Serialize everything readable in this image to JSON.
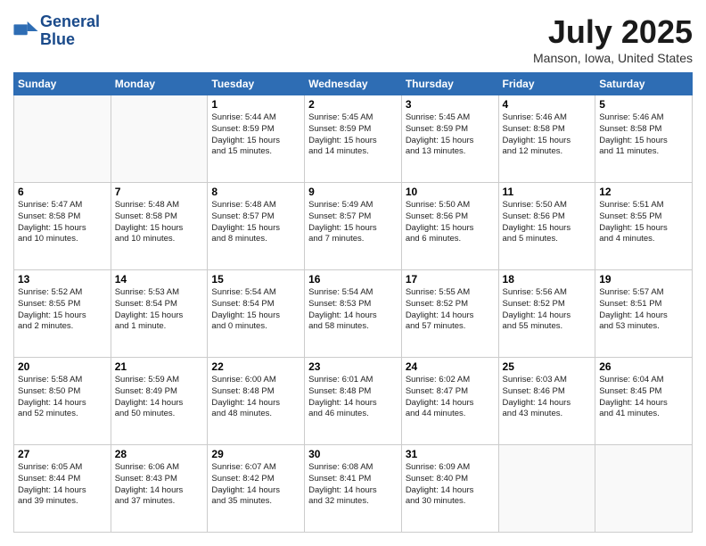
{
  "header": {
    "logo_line1": "General",
    "logo_line2": "Blue",
    "month": "July 2025",
    "location": "Manson, Iowa, United States"
  },
  "weekdays": [
    "Sunday",
    "Monday",
    "Tuesday",
    "Wednesday",
    "Thursday",
    "Friday",
    "Saturday"
  ],
  "weeks": [
    [
      {
        "day": "",
        "info": ""
      },
      {
        "day": "",
        "info": ""
      },
      {
        "day": "1",
        "info": "Sunrise: 5:44 AM\nSunset: 8:59 PM\nDaylight: 15 hours\nand 15 minutes."
      },
      {
        "day": "2",
        "info": "Sunrise: 5:45 AM\nSunset: 8:59 PM\nDaylight: 15 hours\nand 14 minutes."
      },
      {
        "day": "3",
        "info": "Sunrise: 5:45 AM\nSunset: 8:59 PM\nDaylight: 15 hours\nand 13 minutes."
      },
      {
        "day": "4",
        "info": "Sunrise: 5:46 AM\nSunset: 8:58 PM\nDaylight: 15 hours\nand 12 minutes."
      },
      {
        "day": "5",
        "info": "Sunrise: 5:46 AM\nSunset: 8:58 PM\nDaylight: 15 hours\nand 11 minutes."
      }
    ],
    [
      {
        "day": "6",
        "info": "Sunrise: 5:47 AM\nSunset: 8:58 PM\nDaylight: 15 hours\nand 10 minutes."
      },
      {
        "day": "7",
        "info": "Sunrise: 5:48 AM\nSunset: 8:58 PM\nDaylight: 15 hours\nand 10 minutes."
      },
      {
        "day": "8",
        "info": "Sunrise: 5:48 AM\nSunset: 8:57 PM\nDaylight: 15 hours\nand 8 minutes."
      },
      {
        "day": "9",
        "info": "Sunrise: 5:49 AM\nSunset: 8:57 PM\nDaylight: 15 hours\nand 7 minutes."
      },
      {
        "day": "10",
        "info": "Sunrise: 5:50 AM\nSunset: 8:56 PM\nDaylight: 15 hours\nand 6 minutes."
      },
      {
        "day": "11",
        "info": "Sunrise: 5:50 AM\nSunset: 8:56 PM\nDaylight: 15 hours\nand 5 minutes."
      },
      {
        "day": "12",
        "info": "Sunrise: 5:51 AM\nSunset: 8:55 PM\nDaylight: 15 hours\nand 4 minutes."
      }
    ],
    [
      {
        "day": "13",
        "info": "Sunrise: 5:52 AM\nSunset: 8:55 PM\nDaylight: 15 hours\nand 2 minutes."
      },
      {
        "day": "14",
        "info": "Sunrise: 5:53 AM\nSunset: 8:54 PM\nDaylight: 15 hours\nand 1 minute."
      },
      {
        "day": "15",
        "info": "Sunrise: 5:54 AM\nSunset: 8:54 PM\nDaylight: 15 hours\nand 0 minutes."
      },
      {
        "day": "16",
        "info": "Sunrise: 5:54 AM\nSunset: 8:53 PM\nDaylight: 14 hours\nand 58 minutes."
      },
      {
        "day": "17",
        "info": "Sunrise: 5:55 AM\nSunset: 8:52 PM\nDaylight: 14 hours\nand 57 minutes."
      },
      {
        "day": "18",
        "info": "Sunrise: 5:56 AM\nSunset: 8:52 PM\nDaylight: 14 hours\nand 55 minutes."
      },
      {
        "day": "19",
        "info": "Sunrise: 5:57 AM\nSunset: 8:51 PM\nDaylight: 14 hours\nand 53 minutes."
      }
    ],
    [
      {
        "day": "20",
        "info": "Sunrise: 5:58 AM\nSunset: 8:50 PM\nDaylight: 14 hours\nand 52 minutes."
      },
      {
        "day": "21",
        "info": "Sunrise: 5:59 AM\nSunset: 8:49 PM\nDaylight: 14 hours\nand 50 minutes."
      },
      {
        "day": "22",
        "info": "Sunrise: 6:00 AM\nSunset: 8:48 PM\nDaylight: 14 hours\nand 48 minutes."
      },
      {
        "day": "23",
        "info": "Sunrise: 6:01 AM\nSunset: 8:48 PM\nDaylight: 14 hours\nand 46 minutes."
      },
      {
        "day": "24",
        "info": "Sunrise: 6:02 AM\nSunset: 8:47 PM\nDaylight: 14 hours\nand 44 minutes."
      },
      {
        "day": "25",
        "info": "Sunrise: 6:03 AM\nSunset: 8:46 PM\nDaylight: 14 hours\nand 43 minutes."
      },
      {
        "day": "26",
        "info": "Sunrise: 6:04 AM\nSunset: 8:45 PM\nDaylight: 14 hours\nand 41 minutes."
      }
    ],
    [
      {
        "day": "27",
        "info": "Sunrise: 6:05 AM\nSunset: 8:44 PM\nDaylight: 14 hours\nand 39 minutes."
      },
      {
        "day": "28",
        "info": "Sunrise: 6:06 AM\nSunset: 8:43 PM\nDaylight: 14 hours\nand 37 minutes."
      },
      {
        "day": "29",
        "info": "Sunrise: 6:07 AM\nSunset: 8:42 PM\nDaylight: 14 hours\nand 35 minutes."
      },
      {
        "day": "30",
        "info": "Sunrise: 6:08 AM\nSunset: 8:41 PM\nDaylight: 14 hours\nand 32 minutes."
      },
      {
        "day": "31",
        "info": "Sunrise: 6:09 AM\nSunset: 8:40 PM\nDaylight: 14 hours\nand 30 minutes."
      },
      {
        "day": "",
        "info": ""
      },
      {
        "day": "",
        "info": ""
      }
    ]
  ]
}
